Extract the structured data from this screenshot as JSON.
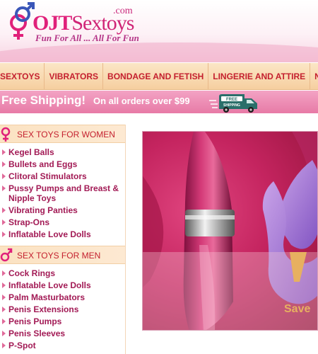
{
  "header": {
    "logo_main": "OJT",
    "logo_rest": "Sextoys",
    "logo_tld": ".com",
    "tagline": "Fun For All ... All For Fun"
  },
  "nav": {
    "items": [
      "SEXTOYS",
      "VIBRATORS",
      "BONDAGE AND FETISH",
      "LINGERIE AND ATTIRE",
      "NECESSITIES"
    ]
  },
  "shipping": {
    "headline": "Free Shipping!",
    "detail": "On all orders over $99",
    "truck_text": "FREE SHIPPING"
  },
  "sidebar": {
    "women": {
      "title": "SEX TOYS FOR WOMEN",
      "items": [
        "Kegel Balls",
        "Bullets and Eggs",
        "Clitoral Stimulators",
        "Pussy Pumps and Breast & Nipple Toys",
        "Vibrating Panties",
        "Strap-Ons",
        "Inflatable Love Dolls"
      ]
    },
    "men": {
      "title": "SEX TOYS FOR MEN",
      "items": [
        "Cock Rings",
        "Inflatable Love Dolls",
        "Palm Masturbators",
        "Penis Extensions",
        "Penis Pumps",
        "Penis Sleeves",
        "P-Spot"
      ]
    }
  },
  "banner": {
    "save_text": "Save"
  },
  "colors": {
    "brand_pink": "#e0207a",
    "nav_text": "#c4202f",
    "link": "#a21a55"
  }
}
